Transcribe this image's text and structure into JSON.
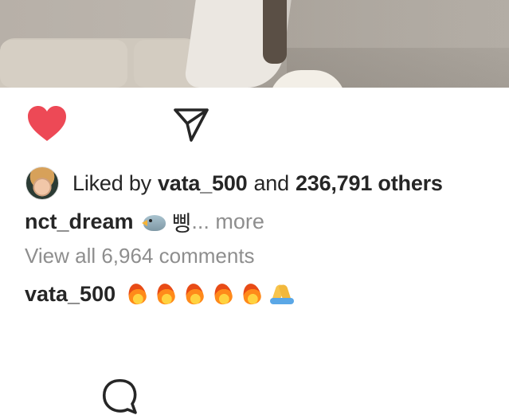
{
  "post": {
    "actions": {
      "like_color": "#ed4956",
      "like_icon": "heart-filled-icon",
      "comment_icon": "comment-bubble-icon",
      "share_icon": "paper-plane-icon"
    },
    "likes": {
      "prefix": "Liked by",
      "user": "vata_500",
      "conj": "and",
      "count": "236,791 others"
    },
    "caption": {
      "author": "nct_dream",
      "emoji": "bird",
      "text": "삥",
      "more": "... more"
    },
    "view_all": "View all 6,964 comments",
    "comment": {
      "author": "vata_500",
      "emojis": [
        "fire",
        "fire",
        "fire",
        "fire",
        "fire",
        "folded-hands"
      ]
    }
  }
}
